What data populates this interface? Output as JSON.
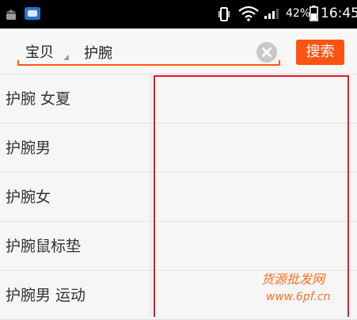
{
  "status_bar": {
    "battery_percent": "42%",
    "time": "16:45",
    "icons": [
      "android-icon",
      "app-notification-icon",
      "vibrate-icon",
      "wifi-icon",
      "signal-icon",
      "battery-icon"
    ]
  },
  "search": {
    "scope_label": "宝贝",
    "query": "护腕",
    "button_label": "搜索"
  },
  "suggestions": [
    {
      "text": "护腕 女夏"
    },
    {
      "text": "护腕男"
    },
    {
      "text": "护腕女"
    },
    {
      "text": "护腕鼠标垫"
    },
    {
      "text": "护腕男 运动"
    }
  ],
  "watermark": {
    "title": "货源批发网",
    "url": "www.6pf.cn"
  },
  "colors": {
    "accent": "#ff5314",
    "highlight_border": "#e01b2c",
    "status_bar": "#000000",
    "watermark": "#ff6f1f"
  }
}
